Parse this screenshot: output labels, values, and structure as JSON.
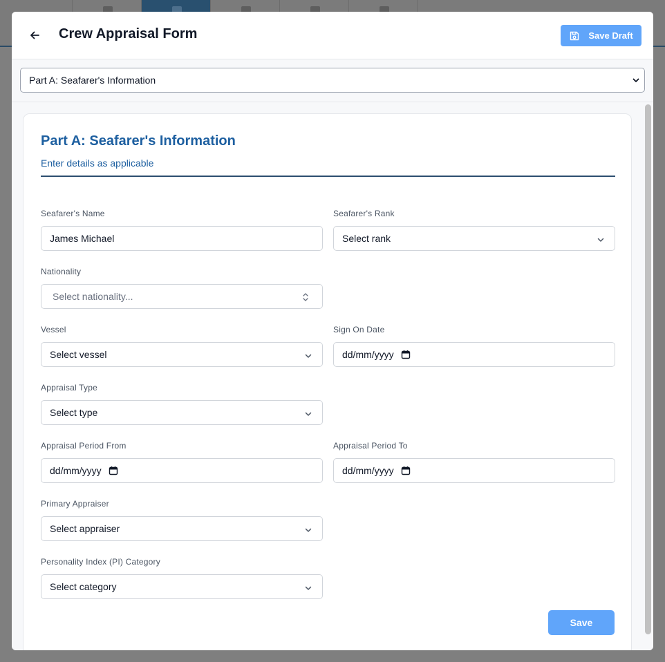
{
  "header": {
    "title": "Crew Appraisal Form",
    "save_draft_label": "Save Draft"
  },
  "part_select": {
    "value": "Part A: Seafarer's Information"
  },
  "section": {
    "title": "Part A: Seafarer's Information",
    "subtitle": "Enter details as applicable"
  },
  "fields": {
    "seafarer_name": {
      "label": "Seafarer's Name",
      "value": "James Michael"
    },
    "seafarer_rank": {
      "label": "Seafarer's Rank",
      "value": "Select rank"
    },
    "nationality": {
      "label": "Nationality",
      "placeholder": "Select nationality..."
    },
    "vessel": {
      "label": "Vessel",
      "value": "Select vessel"
    },
    "sign_on_date": {
      "label": "Sign On Date",
      "value": "dd/mm/yyyy"
    },
    "appraisal_type": {
      "label": "Appraisal Type",
      "value": "Select type"
    },
    "period_from": {
      "label": "Appraisal Period From",
      "value": "dd/mm/yyyy"
    },
    "period_to": {
      "label": "Appraisal Period To",
      "value": "dd/mm/yyyy"
    },
    "primary_appraiser": {
      "label": "Primary Appraiser",
      "value": "Select appraiser"
    },
    "pi_category": {
      "label": "Personality Index (PI) Category",
      "value": "Select category"
    }
  },
  "save_label": "Save",
  "colors": {
    "accent": "#60a5fa",
    "heading": "#1d5fa0",
    "rule": "#2c4e6f"
  },
  "icons": {
    "back": "arrow-left-icon",
    "save_draft": "floppy-disk-icon",
    "select": "chevron-down-icon",
    "combobox": "chevron-up-down-icon",
    "date": "calendar-icon"
  }
}
